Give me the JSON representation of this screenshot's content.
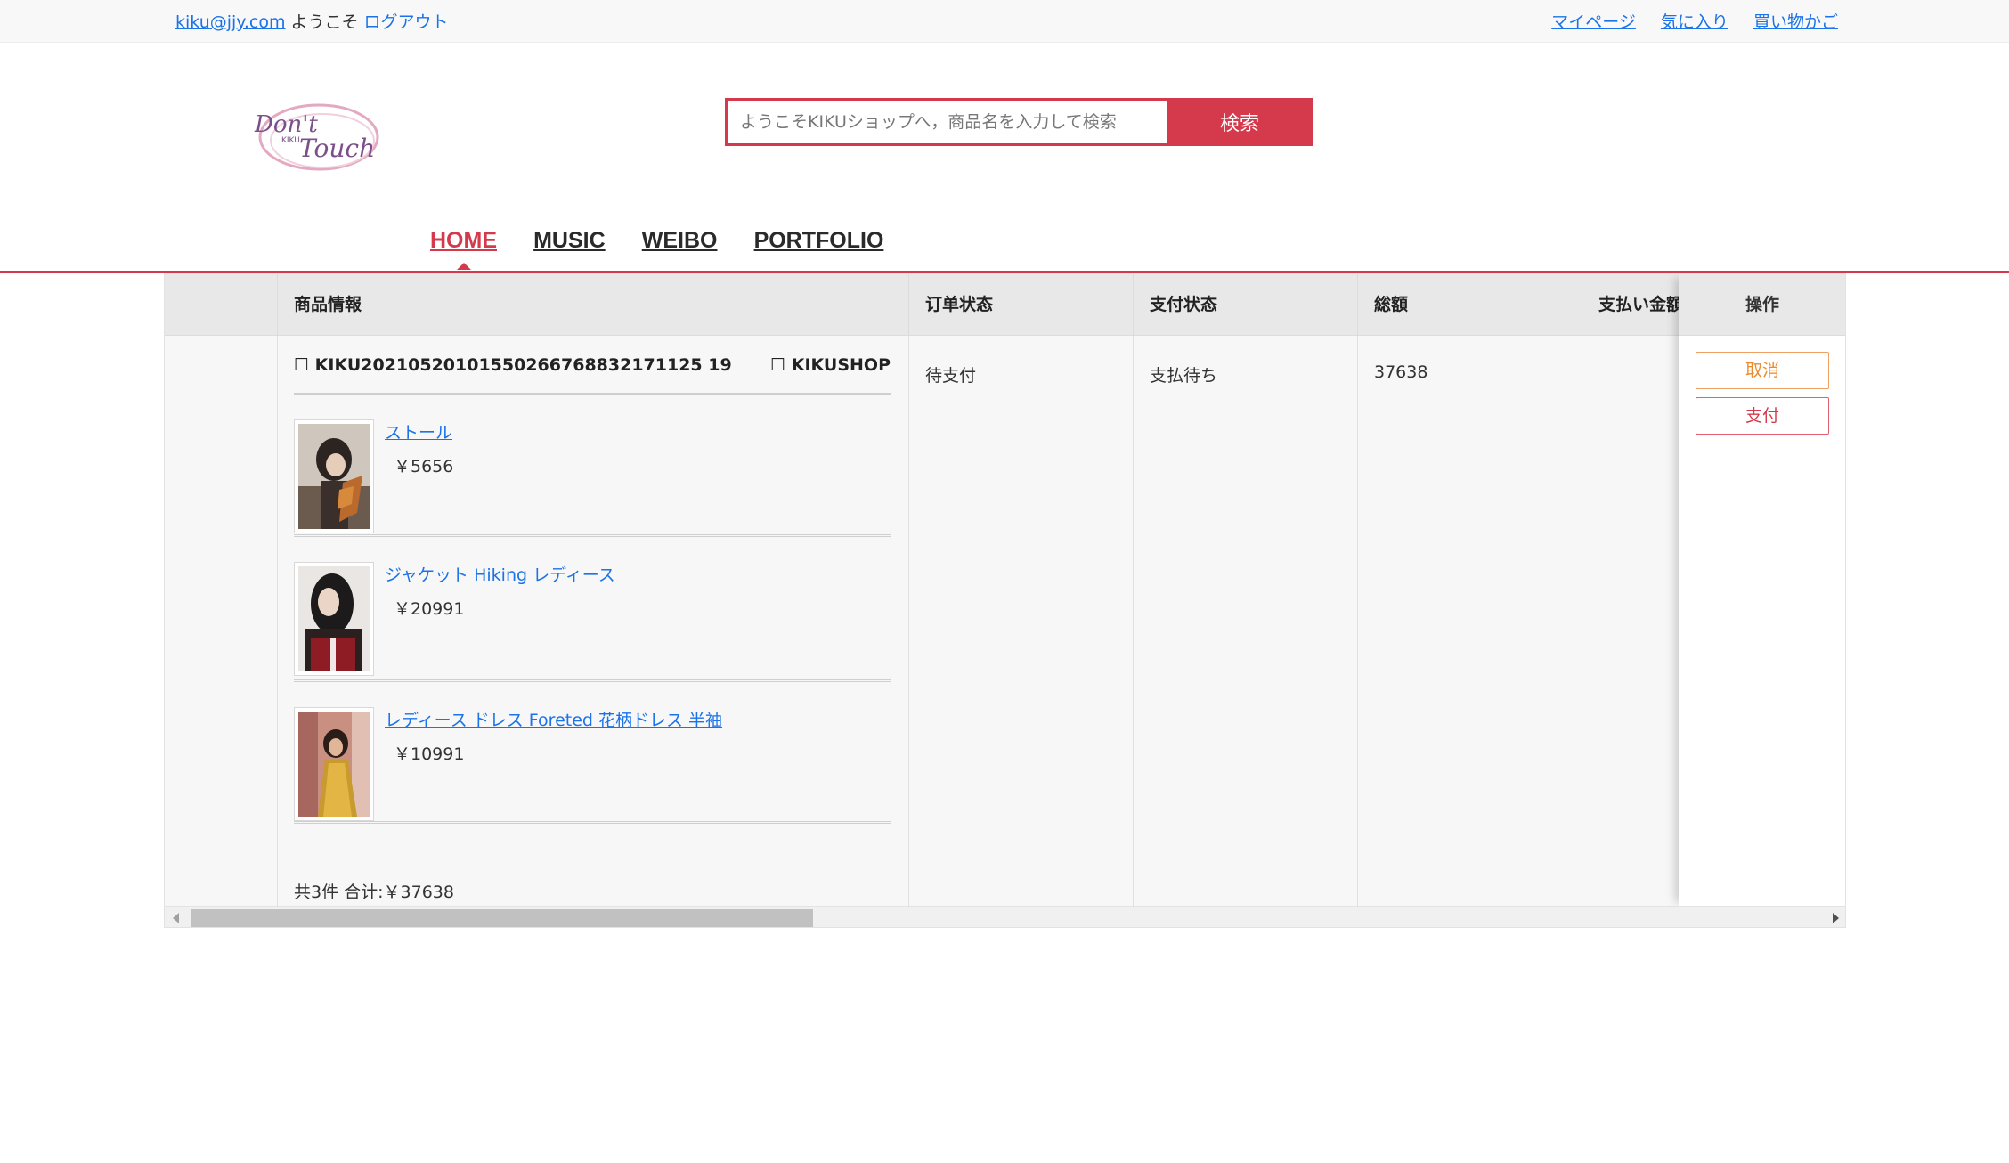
{
  "topbar": {
    "email": "kiku@jjy.com",
    "welcome": "ようこそ",
    "logout": "ログアウト",
    "links": [
      "マイページ",
      "気に入り",
      "買い物かご"
    ]
  },
  "logo": {
    "line1": "Don't",
    "line2": "Touch",
    "small": "KIKU"
  },
  "search": {
    "placeholder": "ようこそKIKUショップへ，商品名を入力して検索",
    "button": "検索"
  },
  "nav": {
    "items": [
      "HOME",
      "MUSIC",
      "WEIBO",
      "PORTFOLIO"
    ],
    "active": "HOME"
  },
  "table": {
    "headers": {
      "info": "商品情報",
      "order_status": "订单状态",
      "pay_status": "支付状态",
      "total": "総額",
      "paid": "支払い金額",
      "ops": "操作"
    },
    "order": {
      "id": "☐ KIKU20210520101550266768832171125 19",
      "shop": "☐ KIKUSHOP",
      "order_status": "待支付",
      "pay_status": "支払待ち",
      "total": "37638",
      "items": [
        {
          "name": "ストール",
          "price": "￥5656"
        },
        {
          "name": "ジャケット Hiking レディース",
          "price": "￥20991"
        },
        {
          "name": "レディース ドレス Foreted 花柄ドレス 半袖",
          "price": "￥10991"
        }
      ],
      "summary": "共3件 合计:￥37638"
    },
    "buttons": {
      "cancel": "取消",
      "pay": "支付"
    }
  },
  "colors": {
    "accent": "#d43a4b",
    "link": "#1a73e8",
    "cancel": "#ec8a2c"
  }
}
